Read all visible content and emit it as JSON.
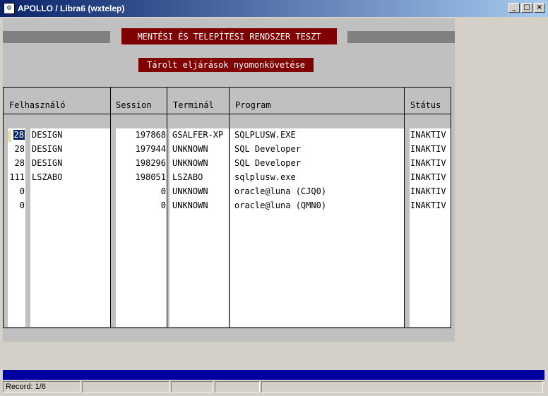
{
  "window": {
    "title": "APOLLO / Libra6 (wxtelep)"
  },
  "form": {
    "main_title": "MENTÉSI ÉS TELEPÍTÉSI RENDSZER TESZT",
    "sub_title": "Tárolt eljárások nyomonkövetése"
  },
  "table": {
    "headers": {
      "user": "Felhasználó",
      "session": "Session",
      "terminal": "Terminál",
      "program": "Program",
      "status": "Státus"
    },
    "rows": [
      {
        "id": "28",
        "user": "DESIGN",
        "session": "197868",
        "terminal": "GSALFER-XP",
        "program": "SQLPLUSW.EXE",
        "status": "INAKTIV"
      },
      {
        "id": "28",
        "user": "DESIGN",
        "session": "197944",
        "terminal": "UNKNOWN",
        "program": "SQL Developer",
        "status": "INAKTIV"
      },
      {
        "id": "28",
        "user": "DESIGN",
        "session": "198296",
        "terminal": "UNKNOWN",
        "program": "SQL Developer",
        "status": "INAKTIV"
      },
      {
        "id": "111",
        "user": "LSZABO",
        "session": "198051",
        "terminal": "LSZABO",
        "program": "sqlplusw.exe",
        "status": "INAKTIV"
      },
      {
        "id": "0",
        "user": "",
        "session": "0",
        "terminal": "UNKNOWN",
        "program": "oracle@luna (CJQ0)",
        "status": "INAKTIV"
      },
      {
        "id": "0",
        "user": "",
        "session": "0",
        "terminal": "UNKNOWN",
        "program": "oracle@luna (QMN0)",
        "status": "INAKTIV"
      }
    ]
  },
  "statusbar": {
    "record": "Record: 1/6"
  },
  "colors": {
    "title_bg": "#800000",
    "titlebar": "#0a246a",
    "form_bg": "#c0c0c0"
  },
  "icons": {
    "app": "app-icon",
    "minimize": "minimize-icon",
    "maximize": "maximize-icon",
    "close": "close-icon"
  }
}
